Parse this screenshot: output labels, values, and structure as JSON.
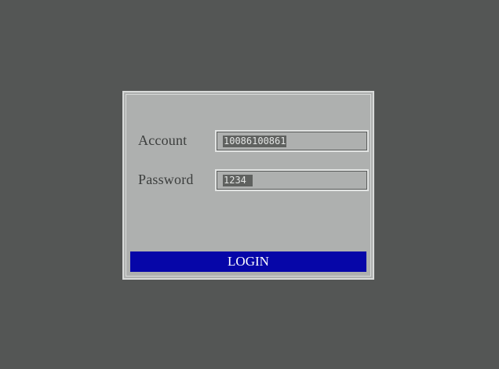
{
  "login_form": {
    "account_label": "Account",
    "account_value": "10086100861",
    "password_label": "Password",
    "password_value": "1234 ",
    "login_button_label": "LOGIN"
  },
  "colors": {
    "desktop_background": "#545655",
    "dialog_background": "#aeb0af",
    "button_background": "#0606a8",
    "button_text": "#ffffff"
  }
}
